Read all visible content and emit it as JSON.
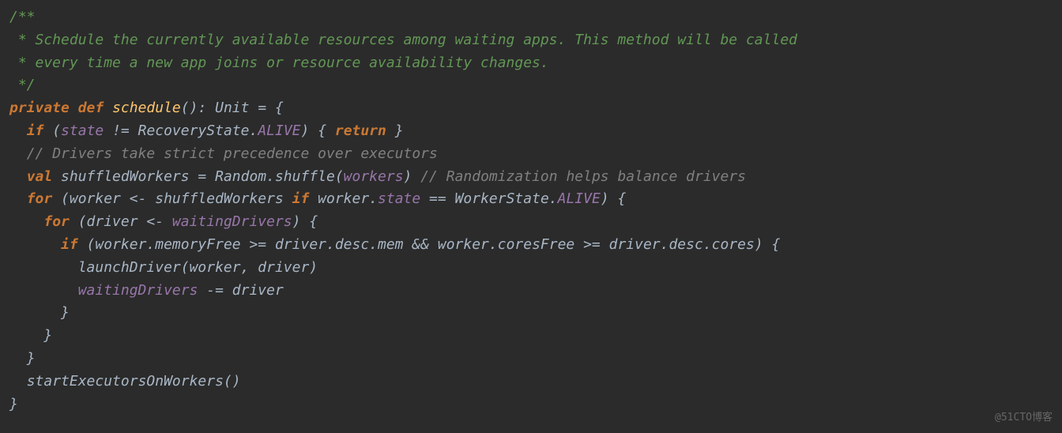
{
  "code": {
    "comment1": "/**",
    "comment2": " * Schedule the currently available resources among waiting apps. This method will be called",
    "comment3": " * every time a new app joins or resource availability changes.",
    "comment4": " */",
    "kw_private": "private",
    "kw_def": "def",
    "fn_schedule": "schedule",
    "sig_parens": "(): ",
    "type_unit": "Unit",
    "eq_brace": " = {",
    "kw_if": "if",
    "if_open": " (",
    "field_state": "state",
    "neq": " != ",
    "recovery_state": "RecoveryState.",
    "alive": "ALIVE",
    "if_close": ") { ",
    "kw_return": "return",
    "close_brace_inline": " }",
    "comment_gray": "// Drivers take strict precedence over executors",
    "kw_val": "val",
    "shuffled": " shuffledWorkers = Random.shuffle(",
    "field_workers": "workers",
    "shuffle_close": ") ",
    "comment_random": "// Randomization helps balance drivers",
    "kw_for": "for",
    "for_open1": " (worker <- shuffledWorkers ",
    "kw_if_inline": "if",
    "worker_dot": " worker.",
    "field_state2": "state",
    "eq_eq": " == ",
    "worker_state": "WorkerState.",
    "alive2": "ALIVE",
    "for_close1": ") {",
    "for_open2": " (driver <- ",
    "field_waiting": "waitingDrivers",
    "for_close2": ") {",
    "if_cond": " (worker.memoryFree >= driver.desc.mem && worker.coresFree >= driver.desc.cores) {",
    "launch": "launchDriver(worker, driver)",
    "minus_eq": " -= driver",
    "brace_close": "}",
    "start_exec": "startExecutorsOnWorkers()"
  },
  "watermark": "@51CTO博客"
}
